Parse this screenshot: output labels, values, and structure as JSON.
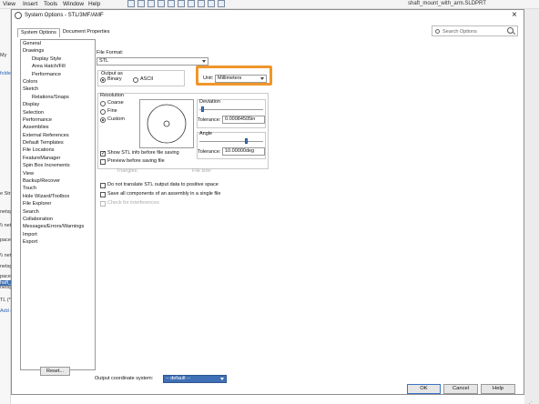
{
  "app": {
    "menu": [
      "View",
      "Insert",
      "Tools",
      "Window",
      "Help"
    ],
    "document_title": "shaft_mount_with_arm.SLDPRT",
    "left_panel_fragments": [
      {
        "text": "My",
        "selected": false,
        "link": false
      },
      {
        "text": "folde",
        "selected": false,
        "link": true
      },
      {
        "text": "e Stre",
        "selected": false,
        "link": false
      },
      {
        "text": "netsp",
        "selected": false,
        "link": false
      },
      {
        "text": "\\\\ net",
        "selected": false,
        "link": false
      },
      {
        "text": "pace)",
        "selected": false,
        "link": false
      },
      {
        "text": "\\\\ nets",
        "selected": false,
        "link": false
      },
      {
        "text": "netsp",
        "selected": false,
        "link": false
      },
      {
        "text": "pace)",
        "selected": false,
        "link": false
      },
      {
        "text": "netsp",
        "selected": false,
        "link": false
      },
      {
        "text": "haft_",
        "selected": true,
        "link": false
      },
      {
        "text": "TL (*",
        "selected": false,
        "link": false
      },
      {
        "text": "Add a",
        "selected": false,
        "link": true
      }
    ]
  },
  "dialog": {
    "title": "System Options - STL/3MF/AMF",
    "tabs": [
      "System Options",
      "Document Properties"
    ],
    "search_placeholder": "Search Options",
    "tree": [
      {
        "label": "General",
        "level": 0
      },
      {
        "label": "Drawings",
        "level": 0
      },
      {
        "label": "Display Style",
        "level": 1
      },
      {
        "label": "Area Hatch/Fill",
        "level": 1
      },
      {
        "label": "Performance",
        "level": 1
      },
      {
        "label": "Colors",
        "level": 0
      },
      {
        "label": "Sketch",
        "level": 0
      },
      {
        "label": "Relations/Snaps",
        "level": 1
      },
      {
        "label": "Display",
        "level": 0
      },
      {
        "label": "Selection",
        "level": 0
      },
      {
        "label": "Performance",
        "level": 0
      },
      {
        "label": "Assemblies",
        "level": 0
      },
      {
        "label": "External References",
        "level": 0
      },
      {
        "label": "Default Templates",
        "level": 0
      },
      {
        "label": "File Locations",
        "level": 0
      },
      {
        "label": "FeatureManager",
        "level": 0
      },
      {
        "label": "Spin Box Increments",
        "level": 0
      },
      {
        "label": "View",
        "level": 0
      },
      {
        "label": "Backup/Recover",
        "level": 0
      },
      {
        "label": "Touch",
        "level": 0
      },
      {
        "label": "Hole Wizard/Toolbox",
        "level": 0
      },
      {
        "label": "File Explorer",
        "level": 0
      },
      {
        "label": "Search",
        "level": 0
      },
      {
        "label": "Collaboration",
        "level": 0
      },
      {
        "label": "Messages/Errors/Warnings",
        "level": 0
      },
      {
        "label": "Import",
        "level": 0
      },
      {
        "label": "Export",
        "level": 0
      }
    ],
    "reset_label": "Reset...",
    "file_format_label": "File Format:",
    "file_format_value": "STL",
    "output_as_label": "Output as",
    "binary_label": "Binary",
    "ascii_label": "ASCII",
    "unit_label": "Unit:",
    "unit_value": "Millimeters",
    "resolution_label": "Resolution",
    "coarse_label": "Coarse",
    "fine_label": "Fine",
    "custom_label": "Custom",
    "deviation_label": "Deviation",
    "deviation_tolerance_label": "Tolerance:",
    "deviation_tolerance_value": "0.00084505in",
    "angle_label": "Angle",
    "angle_tolerance_label": "Tolerance:",
    "angle_tolerance_value": "10.00000deg",
    "show_stl_info_label": "Show STL info before file saving",
    "preview_label": "Preview before saving file",
    "triangles_label": "Triangles:",
    "file_size_label": "File size:",
    "no_translate_label": "Do not translate STL output data to positive space",
    "save_all_label": "Save all components of an assembly in a single file",
    "check_interference_label": "Check for interferences",
    "output_coord_label": "Output coordinate system:",
    "output_coord_value": "-- default --",
    "buttons": {
      "ok": "OK",
      "cancel": "Cancel",
      "help": "Help"
    },
    "state": {
      "binary_selected": true,
      "resolution_selected": "custom",
      "show_stl_info_checked": true,
      "preview_checked": false,
      "no_translate_checked": false,
      "save_all_checked": false
    },
    "colors": {
      "highlight": "#f0962a",
      "selection": "#cfe3fb",
      "accent": "#3f6fb5"
    }
  }
}
